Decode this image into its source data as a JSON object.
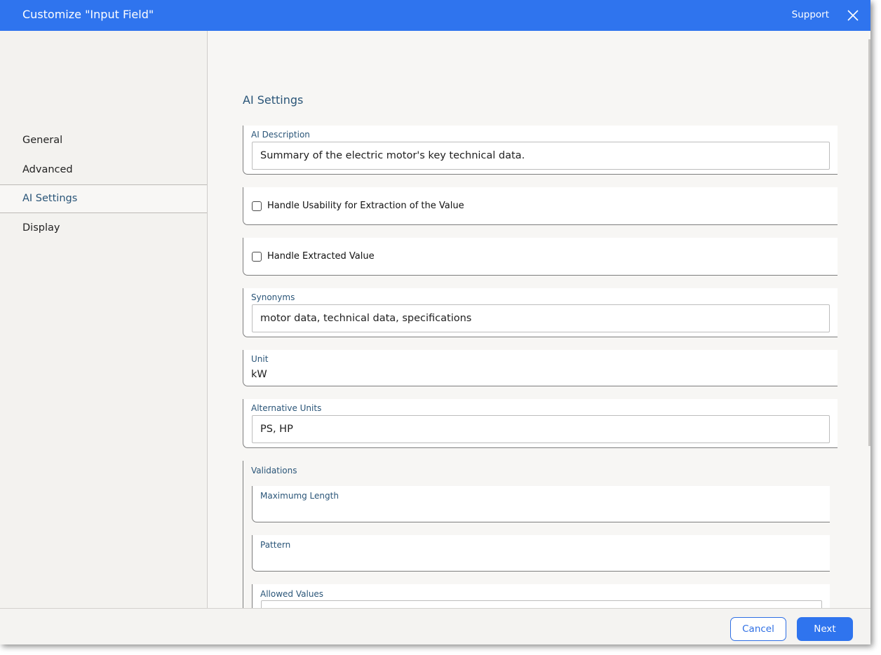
{
  "dialog": {
    "title": "Customize \"Input Field\"",
    "support_label": "Support",
    "close_icon": "close-icon",
    "accent_color": "#2f74ee"
  },
  "sidebar": {
    "items": [
      {
        "label": "General",
        "active": false
      },
      {
        "label": "Advanced",
        "active": false
      },
      {
        "label": "AI Settings",
        "active": true
      },
      {
        "label": "Display",
        "active": false
      }
    ]
  },
  "main": {
    "heading": "AI Settings",
    "ai_description": {
      "label": "AI Description",
      "value": "Summary of the electric motor's key technical data."
    },
    "handle_usability": {
      "label": "Handle Usability for Extraction of the Value",
      "checked": false
    },
    "handle_extracted": {
      "label": "Handle Extracted Value",
      "checked": false
    },
    "synonyms": {
      "label": "Synonyms",
      "value": "motor data, technical data, specifications"
    },
    "unit": {
      "label": "Unit",
      "value": "kW"
    },
    "alternative_units": {
      "label": "Alternative Units",
      "value": "PS, HP"
    },
    "validations": {
      "label": "Validations",
      "max_length": {
        "label": "Maximumg Length",
        "value": ""
      },
      "pattern": {
        "label": "Pattern",
        "value": ""
      },
      "allowed_values": {
        "label": "Allowed Values",
        "value": ""
      }
    }
  },
  "footer": {
    "cancel_label": "Cancel",
    "next_label": "Next"
  }
}
